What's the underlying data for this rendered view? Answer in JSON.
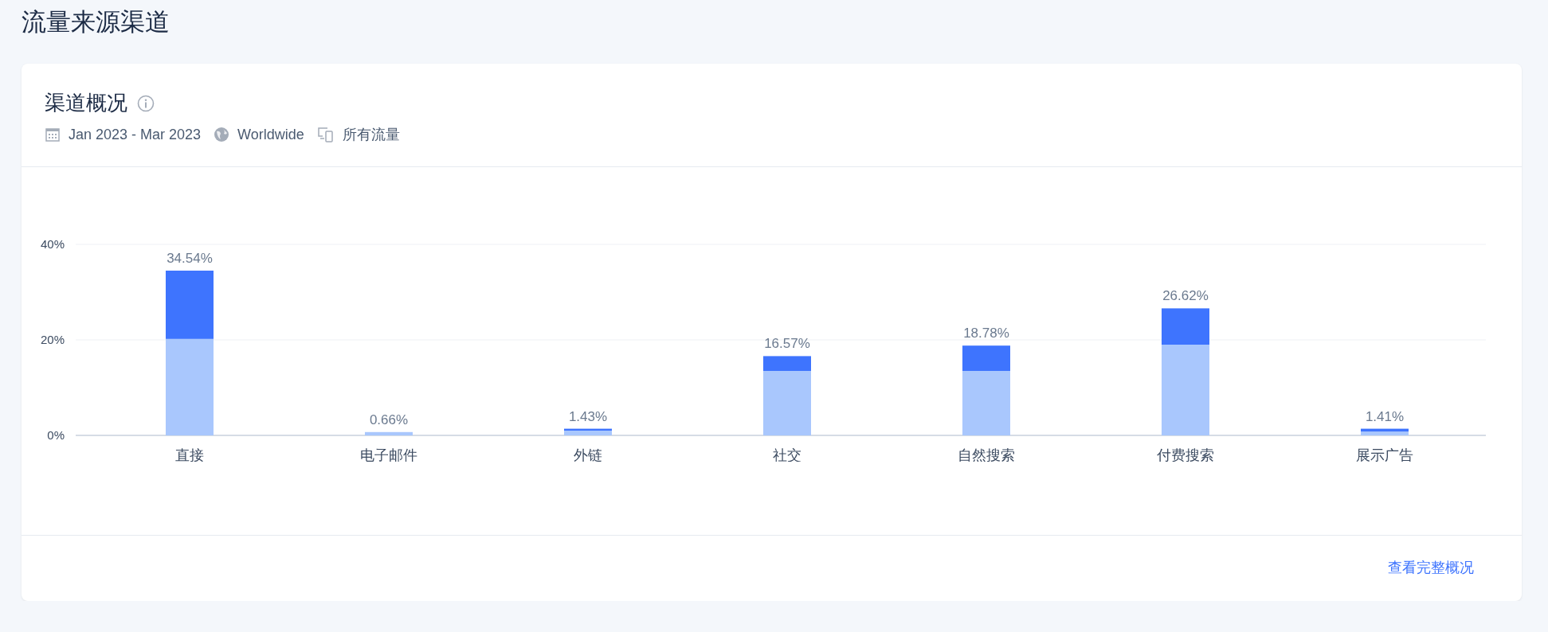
{
  "page_title": "流量来源渠道",
  "card": {
    "title": "渠道概况",
    "date_range": "Jan 2023 - Mar 2023",
    "region": "Worldwide",
    "traffic": "所有流量",
    "chart_data": {
      "type": "bar",
      "stacked": true,
      "categories": [
        "直接",
        "电子邮件",
        "外链",
        "社交",
        "自然搜索",
        "付费搜索",
        "展示广告"
      ],
      "series": [
        {
          "color": "#a9c7fd",
          "values": [
            20.2,
            0.7,
            1.0,
            13.5,
            13.5,
            19.0,
            0.8
          ]
        },
        {
          "color": "#3e74fe",
          "values": [
            14.3,
            0,
            0.4,
            3.1,
            5.3,
            7.6,
            0.6
          ]
        }
      ],
      "ylim": [
        0,
        40
      ],
      "yticks": [
        {
          "value": 0,
          "label": "0%"
        },
        {
          "value": 20,
          "label": "20%"
        },
        {
          "value": 40,
          "label": "40%"
        }
      ],
      "value_labels": [
        "34.54%",
        "0.66%",
        "1.43%",
        "16.57%",
        "18.78%",
        "26.62%",
        "1.41%"
      ]
    },
    "footer_link": "查看完整概况"
  }
}
